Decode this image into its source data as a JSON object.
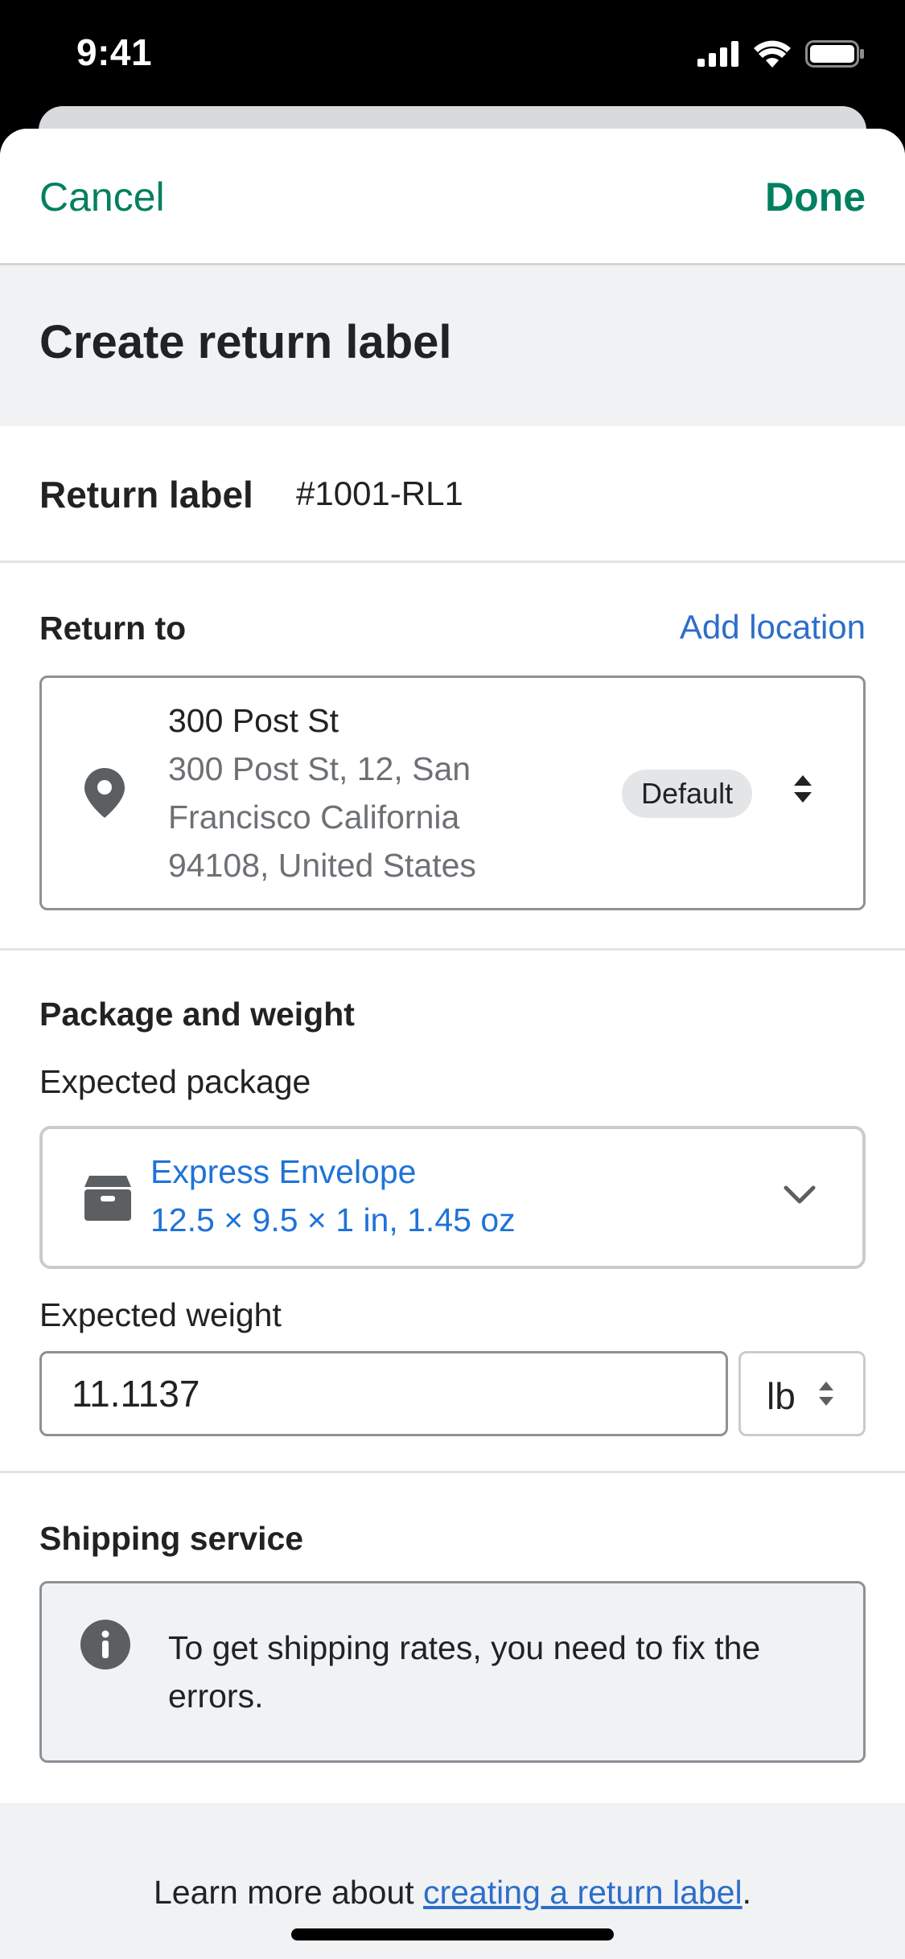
{
  "status_bar": {
    "time": "9:41",
    "icons": [
      "cellular-signal-icon",
      "wifi-icon",
      "battery-icon"
    ]
  },
  "nav": {
    "cancel_label": "Cancel",
    "done_label": "Done"
  },
  "page": {
    "title": "Create return label"
  },
  "return_label": {
    "label": "Return label",
    "value": "#1001-RL1"
  },
  "return_to": {
    "heading": "Return to",
    "add_location_label": "Add location",
    "address": {
      "name": "300 Post St",
      "line1": "300 Post St, 12, San",
      "line2": "Francisco California",
      "line3": "94108, United States",
      "badge": "Default",
      "icon": "location-pin-icon"
    }
  },
  "package": {
    "heading": "Package and weight",
    "expected_package_label": "Expected package",
    "selected_package": {
      "name": "Express Envelope",
      "dimensions": "12.5 × 9.5 × 1 in, 1.45 oz",
      "icon": "package-box-icon"
    },
    "expected_weight_label": "Expected weight",
    "weight_value": "11.1137",
    "weight_unit": "lb"
  },
  "shipping": {
    "heading": "Shipping service",
    "info_message": "To get shipping rates, you need to fix the errors."
  },
  "footer": {
    "prefix": "Learn more about ",
    "link_text": "creating a return label",
    "suffix": "."
  },
  "colors": {
    "accent_green": "#008060",
    "link_blue": "#2c6ecb",
    "package_blue": "#1f73d7",
    "icon_gray": "#5c5f62",
    "background_gray": "#f1f2f4"
  }
}
